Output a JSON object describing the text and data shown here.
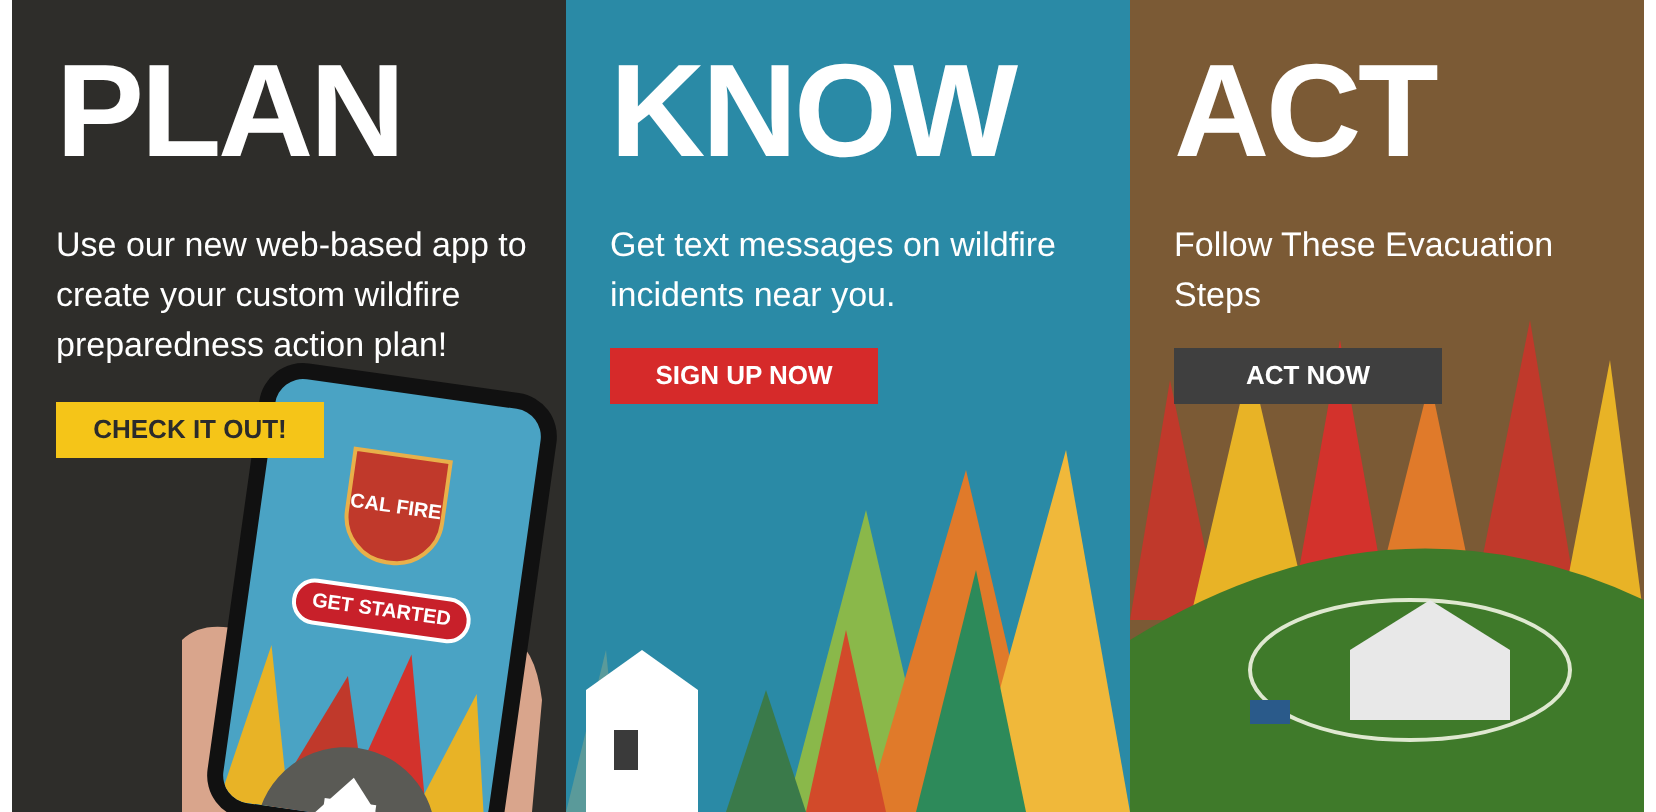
{
  "panels": [
    {
      "kind": "plan",
      "heading": "PLAN",
      "text": "Use our new web-based app to create your custom wildfire preparedness action plan!",
      "button": "CHECK IT OUT!",
      "phone": {
        "logo": "CAL FIRE",
        "button": "GET STARTED"
      }
    },
    {
      "kind": "know",
      "heading": "KNOW",
      "text": "Get text messages on wildfire incidents near you.",
      "button": "SIGN UP NOW"
    },
    {
      "kind": "act",
      "heading": "ACT",
      "text": "Follow These Evacuation Steps",
      "button": "ACT NOW"
    }
  ]
}
